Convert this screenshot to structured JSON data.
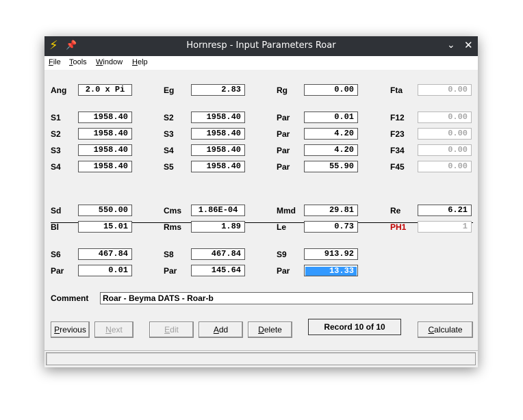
{
  "window": {
    "title": "Hornresp - Input Parameters Roar"
  },
  "icons": {
    "app": "lightning-icon",
    "pin": "pin-icon",
    "minimize": "chevron-down-icon",
    "close": "close-icon"
  },
  "menu": {
    "file": {
      "accel": "F",
      "rest": "ile"
    },
    "tools": {
      "accel": "T",
      "rest": "ools"
    },
    "window": {
      "accel": "W",
      "rest": "indow"
    },
    "help": {
      "accel": "H",
      "rest": "elp"
    }
  },
  "params": {
    "ang": {
      "label": "Ang",
      "value": "2.0 x Pi"
    },
    "eg": {
      "label": "Eg",
      "value": "2.83"
    },
    "rg": {
      "label": "Rg",
      "value": "0.00"
    },
    "fta": {
      "label": "Fta",
      "value": "0.00"
    },
    "row1": [
      {
        "label": "S1",
        "value": "1958.40"
      },
      {
        "label": "S2",
        "value": "1958.40"
      },
      {
        "label": "Par",
        "value": "0.01"
      },
      {
        "label": "F12",
        "value": "0.00"
      }
    ],
    "row2": [
      {
        "label": "S2",
        "value": "1958.40"
      },
      {
        "label": "S3",
        "value": "1958.40"
      },
      {
        "label": "Par",
        "value": "4.20"
      },
      {
        "label": "F23",
        "value": "0.00"
      }
    ],
    "row3": [
      {
        "label": "S3",
        "value": "1958.40"
      },
      {
        "label": "S4",
        "value": "1958.40"
      },
      {
        "label": "Par",
        "value": "4.20"
      },
      {
        "label": "F34",
        "value": "0.00"
      }
    ],
    "row4": [
      {
        "label": "S4",
        "value": "1958.40"
      },
      {
        "label": "S5",
        "value": "1958.40"
      },
      {
        "label": "Par",
        "value": "55.90"
      },
      {
        "label": "F45",
        "value": "0.00"
      }
    ],
    "driver1": [
      {
        "label": "Sd",
        "value": "550.00"
      },
      {
        "label": "Cms",
        "value": "1.86E-04"
      },
      {
        "label": "Mmd",
        "value": "29.81"
      },
      {
        "label": "Re",
        "value": "6.21"
      }
    ],
    "driver2": [
      {
        "label": "Bl",
        "value": "15.01"
      },
      {
        "label": "Rms",
        "value": "1.89"
      },
      {
        "label": "Le",
        "value": "0.73"
      },
      {
        "label": "PH1",
        "value": "1"
      }
    ],
    "chamber1": [
      {
        "label": "S6",
        "value": "467.84"
      },
      {
        "label": "S8",
        "value": "467.84"
      },
      {
        "label": "S9",
        "value": "913.92"
      }
    ],
    "chamber2": [
      {
        "label": "Par",
        "value": "0.01"
      },
      {
        "label": "Par",
        "value": "145.64"
      },
      {
        "label": "Par",
        "value": "13.33"
      }
    ]
  },
  "comment": {
    "label": "Comment",
    "value": "Roar - Beyma DATS - Roar-b"
  },
  "buttons": {
    "previous": {
      "accel": "P",
      "rest": "revious"
    },
    "next": {
      "accel": "N",
      "rest": "ext"
    },
    "edit": {
      "accel": "E",
      "rest": "dit"
    },
    "add": {
      "accel": "A",
      "rest": "dd"
    },
    "delete": {
      "accel": "D",
      "rest": "elete"
    },
    "calculate": {
      "accel": "C",
      "rest": "alculate"
    }
  },
  "record": "Record 10 of 10"
}
